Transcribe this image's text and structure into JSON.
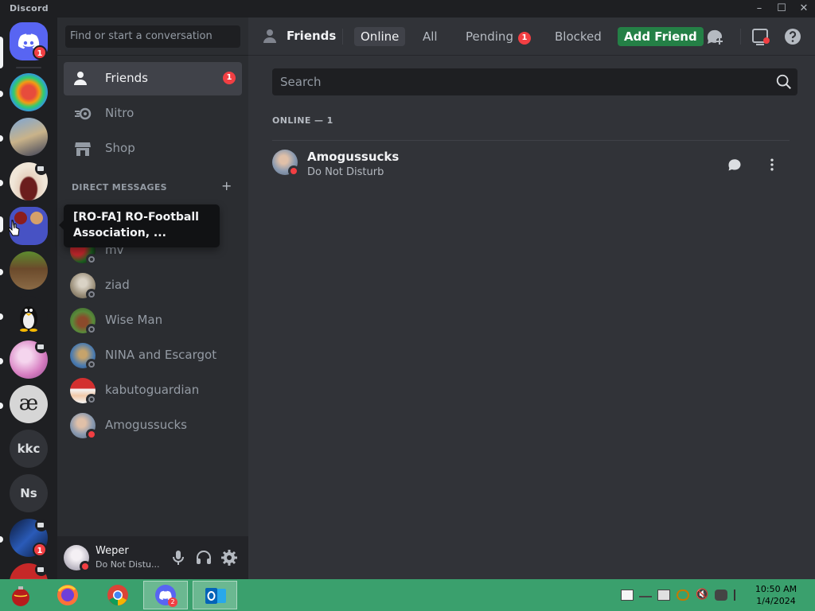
{
  "window": {
    "title": "Discord",
    "controls": [
      "minimize",
      "maximize",
      "close"
    ]
  },
  "rail": {
    "home_badge": "1",
    "servers": [
      {
        "name": "server-1",
        "icon": "colorful-ring"
      },
      {
        "name": "server-2",
        "icon": "cat-piano"
      },
      {
        "name": "server-3",
        "icon": "mouth"
      },
      {
        "name": "server-4",
        "icon": "group-avatar",
        "hovered": true
      },
      {
        "name": "server-5",
        "icon": "pixel-creature"
      },
      {
        "name": "server-6",
        "icon": "tux-penguin"
      },
      {
        "name": "server-7",
        "icon": "anime-pink"
      },
      {
        "name": "server-8",
        "icon": "ae-letter",
        "text": "æ"
      },
      {
        "name": "server-9",
        "text": "kkc"
      },
      {
        "name": "server-10",
        "text": "Ns"
      },
      {
        "name": "server-11",
        "icon": "blue-character",
        "badge": "1"
      },
      {
        "name": "server-12",
        "icon": "santa-hat"
      }
    ]
  },
  "sidebar": {
    "search_placeholder": "Find or start a conversation",
    "nav": [
      {
        "label": "Friends",
        "badge": "1",
        "icon": "friends-icon",
        "active": true
      },
      {
        "label": "Nitro",
        "icon": "nitro-icon"
      },
      {
        "label": "Shop",
        "icon": "shop-icon"
      }
    ],
    "dm_header": "DIRECT MESSAGES",
    "dms": [
      {
        "label": "mv",
        "status": "offline"
      },
      {
        "label": "ziad",
        "status": "offline"
      },
      {
        "label": "Wise Man",
        "status": "offline"
      },
      {
        "label": "NINA and Escargot",
        "status": "offline"
      },
      {
        "label": "kabutoguardian",
        "status": "offline"
      },
      {
        "label": "Amogussucks",
        "status": "dnd"
      }
    ]
  },
  "tooltip": {
    "text": "[RO-FA] RO-Football Association, ..."
  },
  "user_panel": {
    "username": "Weper",
    "status": "Do Not Distu..."
  },
  "header": {
    "title": "Friends",
    "tabs": [
      {
        "label": "Online",
        "active": true
      },
      {
        "label": "All"
      },
      {
        "label": "Pending",
        "badge": "1"
      },
      {
        "label": "Blocked"
      },
      {
        "label": "Add Friend",
        "style": "green"
      }
    ]
  },
  "main": {
    "search_placeholder": "Search",
    "online_header": "ONLINE — 1",
    "friends": [
      {
        "name": "Amogussucks",
        "status": "Do Not Disturb"
      }
    ]
  },
  "taskbar": {
    "apps": [
      "ornament",
      "firefox",
      "chrome",
      "discord",
      "outlook"
    ],
    "discord_badge": "2",
    "time": "10:50 AM",
    "date": "1/4/2024"
  },
  "colors": {
    "blurple": "#5865f2",
    "red": "#f23f43",
    "green_button": "#248046",
    "taskbar": "#3aa06d"
  }
}
